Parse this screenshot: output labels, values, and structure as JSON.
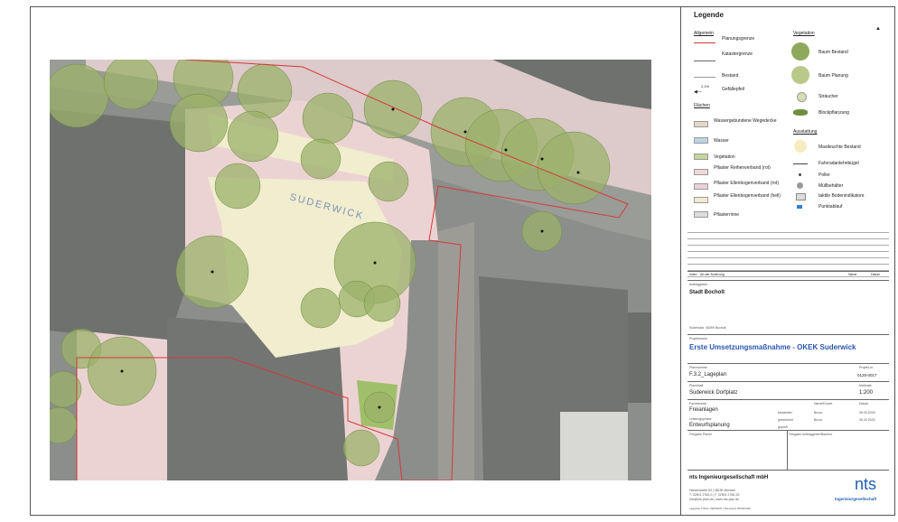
{
  "legend": {
    "title": "Legende",
    "allgemein": {
      "heading": "Allgemein",
      "items": [
        "Planungsgrenze",
        "Katastergrenze",
        "Bestand",
        "Gefällepfeil"
      ],
      "slope_value": "2,1%"
    },
    "flaechen": {
      "heading": "Flächen",
      "items": [
        {
          "label": "Wassergebundene Wegedecke",
          "color": "#e6d8c6"
        },
        {
          "label": "Wasser",
          "color": "#b9d6e6"
        },
        {
          "label": "Vegetation",
          "color": "#c6d59a"
        },
        {
          "label": "Pflaster Reihenverband (rot)",
          "color": "#f0d8d8"
        },
        {
          "label": "Pflaster Ellenbogenverband (rot)",
          "color": "#ead2d6"
        },
        {
          "label": "Pflaster Ellenbogenverband (hell)",
          "color": "#f1edcf"
        },
        {
          "label": "Pflasterrinne",
          "color": "#dcdcdc"
        }
      ]
    },
    "vegetation": {
      "heading": "Vegetation",
      "items": [
        "Baum Bestand",
        "Baum Planung",
        "Sträucher",
        "Blockpflanzung"
      ]
    },
    "ausstattung": {
      "heading": "Ausstattung",
      "items": [
        "Mastleuchte Bestand",
        "Fahrradanlehnbügel",
        "Poller",
        "Müllbehälter",
        "taktile Bodenindikatore",
        "Punktablauf"
      ]
    }
  },
  "revisions": {
    "headers": [
      "Index",
      "Art der Änderung",
      "Name",
      "Datum"
    ]
  },
  "titleblock": {
    "auftraggeber_label": "Auftraggeber",
    "auftraggeber": "Stadt Bocholt",
    "address": "Suderwick, 46399 Bocholt",
    "projektname_label": "Projektname",
    "projektname": "Erste Umsetzungsmaßnahme - OKEK Suderwick",
    "plannummer_label": "Plannummer",
    "plannummer": "F.3.2_Lageplan",
    "projekt_label": "Projekt-nr.",
    "projekt_nr": "0126-0017",
    "planinhalt_label": "Planinhalt",
    "planinhalt": "Suderwick Dorfplatz",
    "massstab_label": "Maßstab",
    "massstab": "1:200",
    "fachbereich_label": "Fachbereich",
    "fachbereich": "Freianlagen",
    "leistungsphase_label": "Leistungsphase",
    "leistungsphase": "Entwurfsplanung",
    "name_label": "Name/Kürzel",
    "datum_label": "Datum",
    "bearbeitet": "bearbeitet",
    "gezeichnet": "gezeichnet",
    "geprueft": "geprüft",
    "name1": "Bruun",
    "name2": "Bruun",
    "date1": "05.03.2026",
    "date2": "05.03.2026",
    "freigabe_planer": "Freigabe Planer",
    "freigabe_ag": "Freigabe Auftraggeber/Bauherr",
    "company": "nts Ingenieurgesellschaft mbH",
    "company_address": "Hansestraße 63 | 48155 Münster",
    "company_phone": "T. 02501 2760-0 | F. 02501 2760-33",
    "company_web": "info@nts-plan.de | www.nts-plan.de",
    "logo_text": "nts",
    "logo_sub": "Ingenieurgesellschaft",
    "footer": "Lageplan FINAL-VERSION | Planstand 05/03/2026"
  },
  "map": {
    "place_name": "SUDERWICK",
    "colors": {
      "paving_red": "#ecd3d3",
      "paving_light": "#f1edcf",
      "tree": "#9bb26a",
      "building": "#767876",
      "boundary": "#d23a3a"
    }
  }
}
